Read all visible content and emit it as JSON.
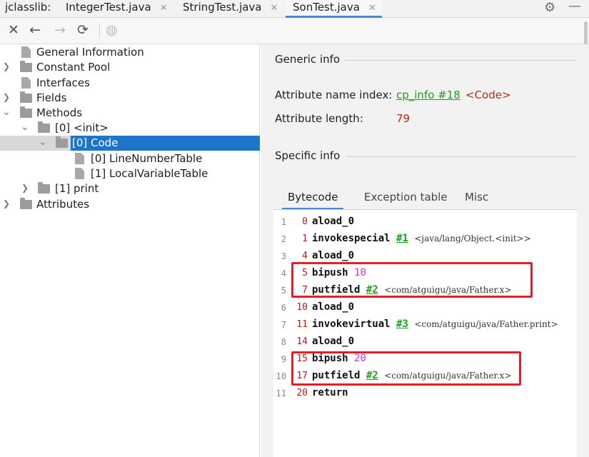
{
  "tabbar": {
    "app_label": "jclasslib:",
    "tabs": [
      {
        "label": "IntegerTest.java",
        "active": false
      },
      {
        "label": "StringTest.java",
        "active": false
      },
      {
        "label": "SonTest.java",
        "active": true
      }
    ],
    "close_glyph": "✕",
    "settings_icon": "gear-icon",
    "minimize_icon": "minus-icon"
  },
  "toolbar": {
    "icons": [
      "close-icon",
      "back-arrow-icon",
      "forward-arrow-icon",
      "refresh-icon",
      "globe-icon"
    ]
  },
  "tree": {
    "items": [
      {
        "label": "General Information"
      },
      {
        "label": "Constant Pool"
      },
      {
        "label": "Interfaces"
      },
      {
        "label": "Fields"
      },
      {
        "label": "Methods"
      },
      {
        "label": "[0] <init>"
      },
      {
        "label": "[0] Code"
      },
      {
        "label": "[0] LineNumberTable"
      },
      {
        "label": "[1] LocalVariableTable"
      },
      {
        "label": "[1] print"
      },
      {
        "label": "Attributes"
      }
    ],
    "selected_index": 6
  },
  "detail": {
    "generic_title": "Generic info",
    "name_index_label": "Attribute name index:",
    "name_index_link": "cp_info #18",
    "name_index_value": "<Code>",
    "length_label": "Attribute length:",
    "length_value": "79",
    "specific_title": "Specific info",
    "subtabs": [
      "Bytecode",
      "Exception table",
      "Misc"
    ],
    "active_subtab": "Bytecode"
  },
  "bytecode": [
    {
      "line": "1",
      "offset": "0",
      "op": "aload_0",
      "num": "",
      "ref": "",
      "comment": ""
    },
    {
      "line": "2",
      "offset": "1",
      "op": "invokespecial",
      "num": "",
      "ref": "#1",
      "comment": "<java/lang/Object.<init>>"
    },
    {
      "line": "3",
      "offset": "4",
      "op": "aload_0",
      "num": "",
      "ref": "",
      "comment": ""
    },
    {
      "line": "4",
      "offset": "5",
      "op": "bipush",
      "num": "10",
      "ref": "",
      "comment": ""
    },
    {
      "line": "5",
      "offset": "7",
      "op": "putfield",
      "num": "",
      "ref": "#2",
      "comment": "<com/atguigu/java/Father.x>"
    },
    {
      "line": "6",
      "offset": "10",
      "op": "aload_0",
      "num": "",
      "ref": "",
      "comment": ""
    },
    {
      "line": "7",
      "offset": "11",
      "op": "invokevirtual",
      "num": "",
      "ref": "#3",
      "comment": "<com/atguigu/java/Father.print>"
    },
    {
      "line": "8",
      "offset": "14",
      "op": "aload_0",
      "num": "",
      "ref": "",
      "comment": ""
    },
    {
      "line": "9",
      "offset": "15",
      "op": "bipush",
      "num": "20",
      "ref": "",
      "comment": ""
    },
    {
      "line": "10",
      "offset": "17",
      "op": "putfield",
      "num": "",
      "ref": "#2",
      "comment": "<com/atguigu/java/Father.x>"
    },
    {
      "line": "11",
      "offset": "20",
      "op": "return",
      "num": "",
      "ref": "",
      "comment": ""
    }
  ],
  "colors": {
    "selection": "#1e74c8",
    "link_green": "#1a9e1a",
    "value_red": "#c0281c",
    "number_magenta": "#cc33cc",
    "highlight_red": "#e0202a"
  }
}
